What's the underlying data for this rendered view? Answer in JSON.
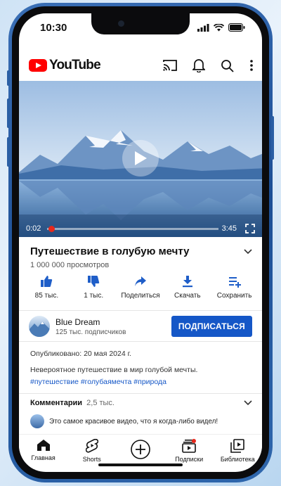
{
  "status_bar": {
    "time": "10:30"
  },
  "app": {
    "name": "YouTube",
    "brand_color": "#ff0000"
  },
  "top_actions": [
    "cast-icon",
    "bell-icon",
    "search-icon",
    "more-vert-icon"
  ],
  "player": {
    "current_time": "0:02",
    "duration": "3:45",
    "progress": 0.01
  },
  "video": {
    "title": "Путешествие в голубую мечту",
    "views": "1 000 000 просмотров"
  },
  "actions": [
    {
      "icon": "thumb-up-icon",
      "label": "85 тыс."
    },
    {
      "icon": "thumb-down-icon",
      "label": "1 тыс."
    },
    {
      "icon": "share-icon",
      "label": "Поделиться"
    },
    {
      "icon": "download-icon",
      "label": "Скачать"
    },
    {
      "icon": "save-playlist-icon",
      "label": "Сохранить"
    }
  ],
  "channel": {
    "name": "Blue Dream",
    "subscribers": "125 тыс. подписчиков",
    "subscribe_label": "ПОДПИСАТЬСЯ",
    "accent": "#1557c7"
  },
  "description": {
    "published": "Опубликовано: 20 мая 2024 г.",
    "text": "Невероятное путешествие в мир голубой мечты.",
    "hashtags": "#путешествие #голубаямечта #природа"
  },
  "comments": {
    "title": "Комментарии",
    "count": "2,5 тыс.",
    "top_comment": "Это самое красивое видео, что я когда-либо видел!"
  },
  "bottom_nav": [
    {
      "icon": "home-icon",
      "label": "Главная"
    },
    {
      "icon": "shorts-icon",
      "label": "Shorts"
    },
    {
      "icon": "create-plus-icon",
      "label": ""
    },
    {
      "icon": "subscriptions-icon",
      "label": "Подписки"
    },
    {
      "icon": "library-icon",
      "label": "Библиотека"
    }
  ]
}
